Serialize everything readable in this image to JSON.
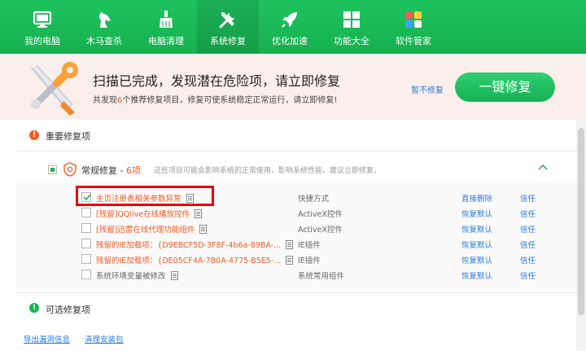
{
  "nav": {
    "items": [
      {
        "label": "我的电脑",
        "icon": "monitor-icon"
      },
      {
        "label": "木马查杀",
        "icon": "horse-icon"
      },
      {
        "label": "电脑清理",
        "icon": "broom-icon"
      },
      {
        "label": "系统修复",
        "icon": "wrench-screwdriver-icon",
        "active": true
      },
      {
        "label": "优化加速",
        "icon": "rocket-icon"
      },
      {
        "label": "功能大全",
        "icon": "grid-icon"
      },
      {
        "label": "软件管家",
        "icon": "software-grid-icon"
      }
    ]
  },
  "banner": {
    "title": "扫描已完成，发现潜在危险项，请立即修复",
    "subtitle_prefix": "共发现",
    "subtitle_count": "6",
    "subtitle_suffix": "个推荐修复项目，修复可使系统稳定正常运行，请立即修复!",
    "skip_label": "暂不修复",
    "fix_button_label": "一键修复"
  },
  "sections": {
    "important_title": "重要修复项",
    "optional_title": "可选修复项"
  },
  "group": {
    "name": "常规修复 - ",
    "count": "6项",
    "description": "这些项目可能会影响系统的正常使用，影响系统性能，建议立即修复。"
  },
  "items": [
    {
      "name": "主页注册表相关参数异常",
      "type": "快捷方式",
      "action": "直接删除",
      "trust": "信任",
      "checked": true,
      "color": "red"
    },
    {
      "name": "[残留]QQlive在线播放控件",
      "type": "ActiveX控件",
      "action": "恢复默认",
      "trust": "信任",
      "checked": false,
      "color": "red"
    },
    {
      "name": "[残留]迅雷在线代理功能组件",
      "type": "ActiveX控件",
      "action": "恢复默认",
      "trust": "信任",
      "checked": false,
      "color": "red"
    },
    {
      "name": "残留的IE加载项：{D9EBCF5D-3F8F-4b6a-89BA-...",
      "type": "IE插件",
      "action": "恢复默认",
      "trust": "信任",
      "checked": false,
      "color": "red"
    },
    {
      "name": "残留的IE加载项：{DE05CF4A-7B0A-4775-B5E5-...",
      "type": "IE插件",
      "action": "恢复默认",
      "trust": "信任",
      "checked": false,
      "color": "red"
    },
    {
      "name": "系统环境变量被修改",
      "type": "系统常用组件",
      "action": "恢复默认",
      "trust": "信任",
      "checked": false,
      "color": "gray"
    }
  ],
  "footer": {
    "export_label": "导出漏洞信息",
    "clean_label": "清理安装包"
  },
  "colors": {
    "brand_green": "#1fc35f",
    "warning_orange": "#f25b24",
    "link_blue": "#2b7bd9",
    "highlight_red": "#e60012"
  }
}
